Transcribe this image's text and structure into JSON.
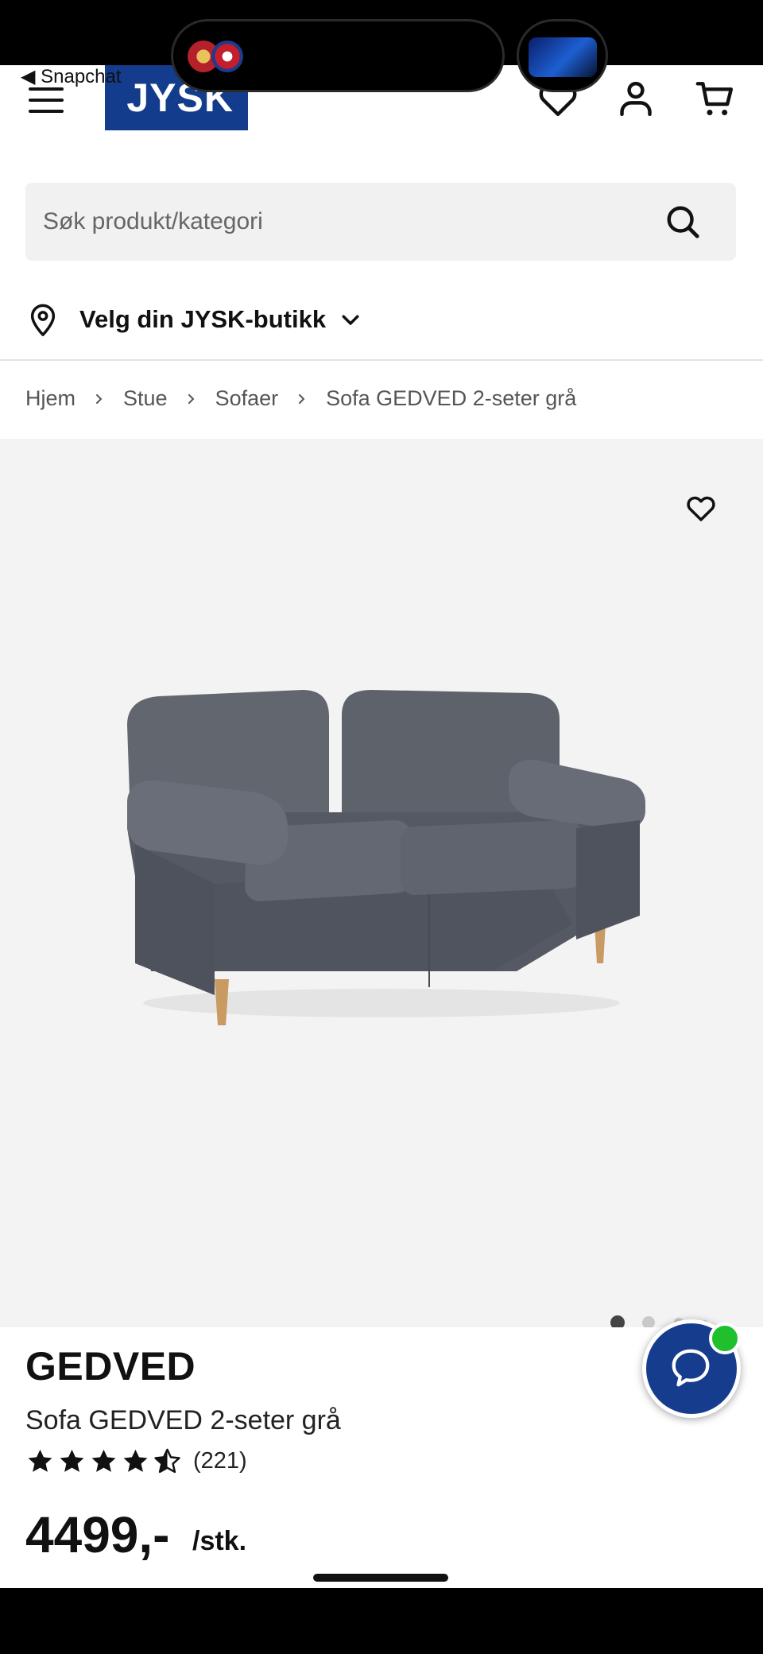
{
  "status": {
    "back_app": "◀ Snapchat"
  },
  "header": {
    "logo_text": "JYSK",
    "icons": [
      "menu-icon",
      "heart-icon",
      "user-icon",
      "cart-icon"
    ]
  },
  "search": {
    "placeholder": "Søk produkt/kategori"
  },
  "store": {
    "label": "Velg din JYSK-butikk"
  },
  "breadcrumb": {
    "items": [
      "Hjem",
      "Stue",
      "Sofaer",
      "Sofa GEDVED 2-seter grå"
    ]
  },
  "gallery": {
    "image_count": 4,
    "active_index": 0
  },
  "product": {
    "brand": "GEDVED",
    "name": "Sofa GEDVED 2-seter grå",
    "rating": 4.5,
    "rating_count": "(221)",
    "price": "4499,-",
    "unit": "/stk."
  },
  "colors": {
    "brand_blue": "#143c8c",
    "online_green": "#1fbf2e",
    "sofa_grey": "#5a5f6b"
  }
}
